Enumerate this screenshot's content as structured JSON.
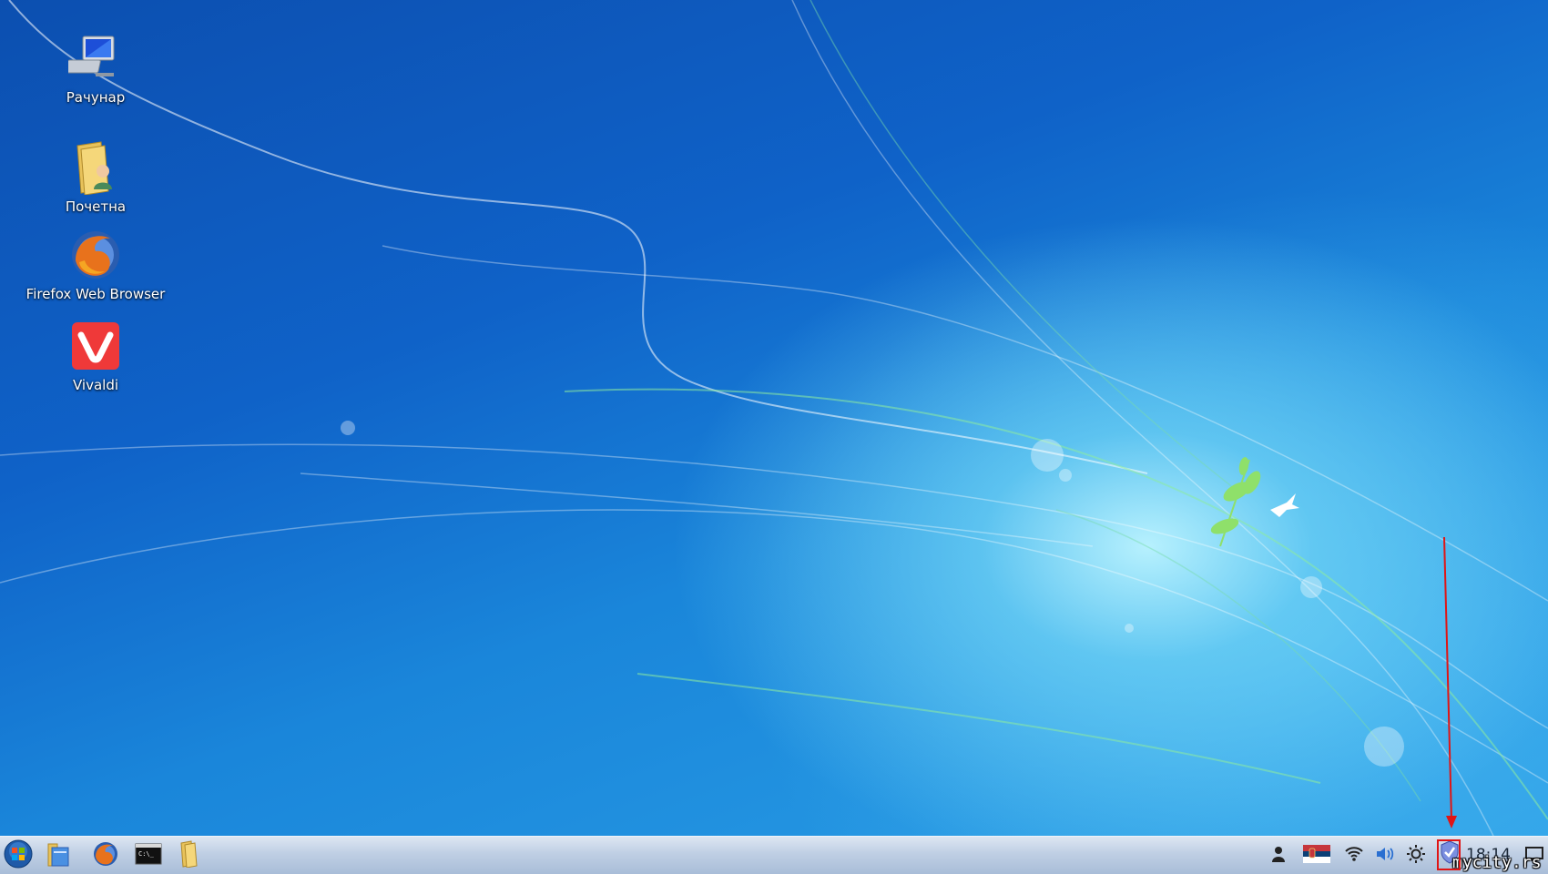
{
  "desktop": {
    "icons": [
      {
        "label": "Рачунар",
        "icon": "computer-icon"
      },
      {
        "label": "Почетна",
        "icon": "home-folder-icon"
      },
      {
        "label": "Firefox Web Browser",
        "icon": "firefox-icon"
      },
      {
        "label": "Vivaldi",
        "icon": "vivaldi-icon"
      }
    ]
  },
  "taskbar": {
    "start_icon": "start-orb-icon",
    "pinned": [
      {
        "icon": "file-manager-icon"
      },
      {
        "icon": "firefox-icon"
      },
      {
        "icon": "terminal-icon"
      },
      {
        "icon": "folder-icon"
      }
    ],
    "tray": [
      {
        "icon": "user-icon"
      },
      {
        "icon": "serbian-flag-icon"
      },
      {
        "icon": "wifi-icon"
      },
      {
        "icon": "volume-icon"
      },
      {
        "icon": "brightness-icon"
      },
      {
        "icon": "shield-update-icon"
      }
    ],
    "clock": "18:14",
    "show_desktop_icon": "show-desktop-icon"
  },
  "watermark": "mycity.rs",
  "colors": {
    "taskbar": "#bfcfe4",
    "annotation": "#e01515",
    "accent": "#1a86da"
  }
}
